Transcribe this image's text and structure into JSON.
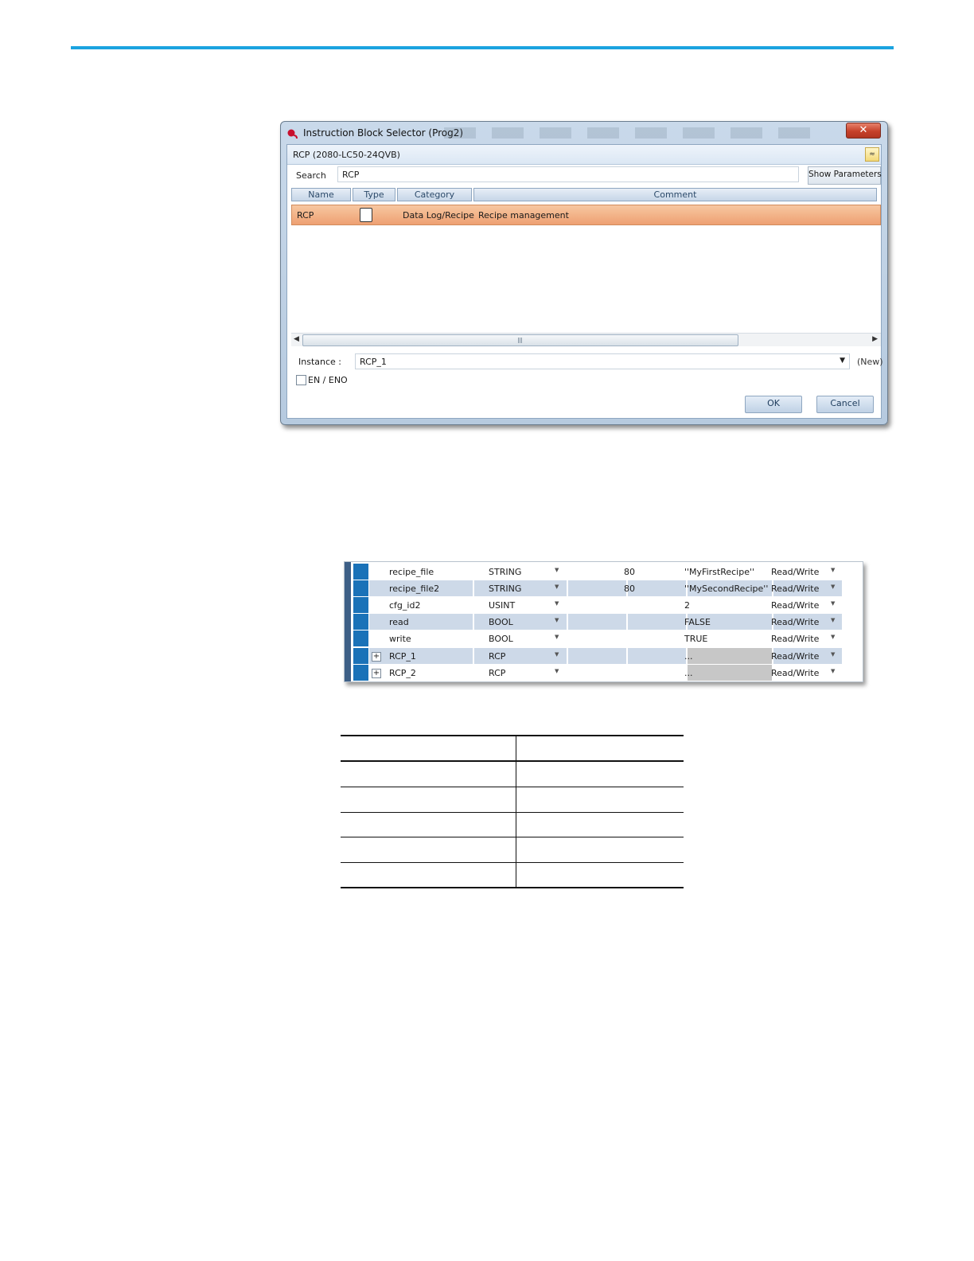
{
  "dialog": {
    "title": "Instruction Block Selector (Prog2)",
    "close_label": "✕",
    "header_label": "RCP (2080-LC50-24QVB)",
    "collapse_label": "≈",
    "search": {
      "label": "Search",
      "value": "RCP"
    },
    "show_parameters_label": "Show Parameters",
    "columns": [
      "Name",
      "Type",
      "Category",
      "Comment"
    ],
    "rows": [
      {
        "name": "RCP",
        "category": "Data Log/Recipe",
        "comment": "Recipe management"
      }
    ],
    "instance": {
      "label": "Instance :",
      "value": "RCP_1",
      "suffix": "(New)"
    },
    "en_eno_label": "EN / ENO",
    "ok_label": "OK",
    "cancel_label": "Cancel"
  },
  "variables": {
    "rows": [
      {
        "name": "recipe_file",
        "type": "STRING",
        "dim": "80",
        "initial": "''MyFirstRecipe''",
        "access": "Read/Write"
      },
      {
        "name": "recipe_file2",
        "type": "STRING",
        "dim": "80",
        "initial": "''MySecondRecipe''",
        "access": "Read/Write"
      },
      {
        "name": "cfg_id2",
        "type": "USINT",
        "dim": "",
        "initial": "2",
        "access": "Read/Write"
      },
      {
        "name": "read",
        "type": "BOOL",
        "dim": "",
        "initial": "FALSE",
        "access": "Read/Write"
      },
      {
        "name": "write",
        "type": "BOOL",
        "dim": "",
        "initial": "TRUE",
        "access": "Read/Write"
      },
      {
        "name": "RCP_1",
        "type": "RCP",
        "dim": "",
        "initial": "...",
        "access": "Read/Write"
      },
      {
        "name": "RCP_2",
        "type": "RCP",
        "dim": "",
        "initial": "...",
        "access": "Read/Write"
      }
    ],
    "expander_label": "+",
    "dropdown_glyph": "▼"
  }
}
